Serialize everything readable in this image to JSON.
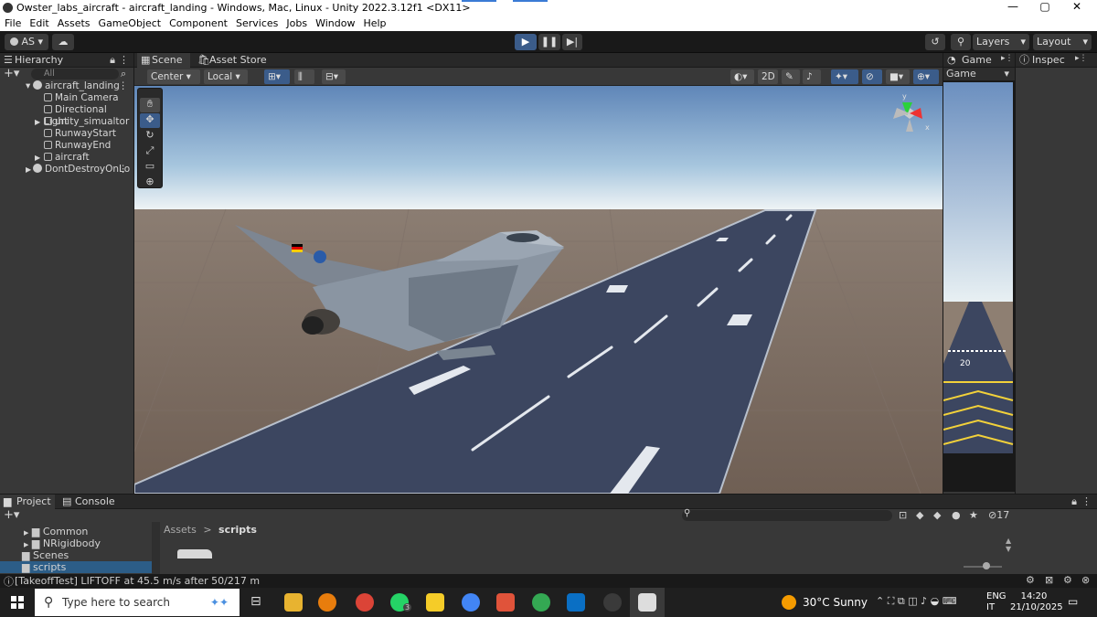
{
  "window": {
    "title": "Owster_labs_aircraft - aircraft_landing - Windows, Mac, Linux - Unity 2022.3.12f1 <DX11>"
  },
  "menu": [
    "File",
    "Edit",
    "Assets",
    "GameObject",
    "Component",
    "Services",
    "Jobs",
    "Window",
    "Help"
  ],
  "toolbar": {
    "account": "AS",
    "layers": "Layers",
    "layout": "Layout"
  },
  "hierarchy": {
    "tab": "Hierarchy",
    "search_placeholder": "All",
    "items": [
      {
        "label": "aircraft_landing"
      },
      {
        "label": "Main Camera"
      },
      {
        "label": "Directional Light"
      },
      {
        "label": "unity_simualtor"
      },
      {
        "label": "RunwayStart"
      },
      {
        "label": "RunwayEnd"
      },
      {
        "label": "aircraft"
      },
      {
        "label": "DontDestroyOnLo"
      }
    ]
  },
  "scene": {
    "tab_scene": "Scene",
    "tab_store": "Asset Store",
    "pivot": "Center",
    "space": "Local",
    "mode2d": "2D",
    "gizmo_axes": {
      "y": "y",
      "x": "x"
    },
    "runway_number": "20"
  },
  "game": {
    "tab": "Game",
    "display": "Game"
  },
  "inspector": {
    "tab": "Inspec"
  },
  "bottom": {
    "tab_project": "Project",
    "tab_console": "Console",
    "breadcrumb_root": "Assets",
    "breadcrumb_sep": ">",
    "breadcrumb_current": "scripts",
    "folders": [
      {
        "label": "Common"
      },
      {
        "label": "NRigidbody"
      },
      {
        "label": "Scenes"
      },
      {
        "label": "scripts"
      }
    ],
    "hidden_count": "17"
  },
  "status": {
    "message": "[TakeoffTest] LIFTOFF at 45.5 m/s after 50/217 m"
  },
  "taskbar": {
    "search_placeholder": "Type here to search",
    "weather": "30°C  Sunny",
    "lang1": "ENG",
    "lang2": "IT",
    "time": "14:20",
    "date": "21/10/2025",
    "whatsapp_badge": "3"
  }
}
